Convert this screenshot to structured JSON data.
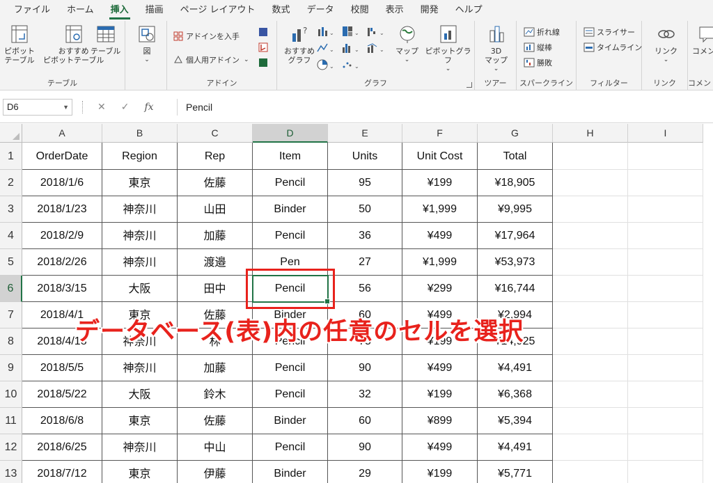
{
  "tabs": [
    "ファイル",
    "ホーム",
    "挿入",
    "描画",
    "ページ レイアウト",
    "数式",
    "データ",
    "校閲",
    "表示",
    "開発",
    "ヘルプ"
  ],
  "active_tab": "挿入",
  "ribbon": {
    "table_group": {
      "label": "テーブル",
      "pivot": "ピボット\nテーブル",
      "recommended_pivot": "おすすめ\nピボットテーブル",
      "table": "テーブル"
    },
    "illust_group": {
      "figure": "図"
    },
    "addin_group": {
      "label": "アドイン",
      "get_addins": "アドインを入手",
      "my_addins": "個人用アドイン"
    },
    "chart_group": {
      "label": "グラフ",
      "recommended_charts": "おすすめ\nグラフ",
      "map": "マップ",
      "pivot_chart": "ピボットグラフ"
    },
    "tour_group": {
      "label": "ツアー",
      "map3d": "3D\nマップ"
    },
    "sparkline_group": {
      "label": "スパークライン",
      "line": "折れ線",
      "column": "縦棒",
      "winloss": "勝敗"
    },
    "filter_group": {
      "label": "フィルター",
      "slicer": "スライサー",
      "timeline": "タイムライン"
    },
    "link_group": {
      "label": "リンク",
      "link": "リンク"
    },
    "comment_group": {
      "label": "コメント",
      "comment": "コメント"
    }
  },
  "namebox": "D6",
  "formula": "Pencil",
  "columns": [
    "A",
    "B",
    "C",
    "D",
    "E",
    "F",
    "G",
    "H",
    "I"
  ],
  "selected_column": "D",
  "selected_row": 6,
  "headers": [
    "OrderDate",
    "Region",
    "Rep",
    "Item",
    "Units",
    "Unit Cost",
    "Total"
  ],
  "rows": [
    [
      "2018/1/6",
      "東京",
      "佐藤",
      "Pencil",
      "95",
      "¥199",
      "¥18,905"
    ],
    [
      "2018/1/23",
      "神奈川",
      "山田",
      "Binder",
      "50",
      "¥1,999",
      "¥9,995"
    ],
    [
      "2018/2/9",
      "神奈川",
      "加藤",
      "Pencil",
      "36",
      "¥499",
      "¥17,964"
    ],
    [
      "2018/2/26",
      "神奈川",
      "渡邉",
      "Pen",
      "27",
      "¥1,999",
      "¥53,973"
    ],
    [
      "2018/3/15",
      "大阪",
      "田中",
      "Pencil",
      "56",
      "¥299",
      "¥16,744"
    ],
    [
      "2018/4/1",
      "東京",
      "佐藤",
      "Binder",
      "60",
      "¥499",
      "¥2,994"
    ],
    [
      "2018/4/18",
      "神奈川",
      "林",
      "Pencil",
      "75",
      "¥199",
      "¥14,925"
    ],
    [
      "2018/5/5",
      "神奈川",
      "加藤",
      "Pencil",
      "90",
      "¥499",
      "¥4,491"
    ],
    [
      "2018/5/22",
      "大阪",
      "鈴木",
      "Pencil",
      "32",
      "¥199",
      "¥6,368"
    ],
    [
      "2018/6/8",
      "東京",
      "佐藤",
      "Binder",
      "60",
      "¥899",
      "¥5,394"
    ],
    [
      "2018/6/25",
      "神奈川",
      "中山",
      "Pencil",
      "90",
      "¥499",
      "¥4,491"
    ],
    [
      "2018/7/12",
      "東京",
      "伊藤",
      "Binder",
      "29",
      "¥199",
      "¥5,771"
    ]
  ],
  "annotation": "データベース(表)内の任意のセルを選択",
  "colors": {
    "excel_green": "#217346",
    "annotation_red": "#e8221c"
  }
}
